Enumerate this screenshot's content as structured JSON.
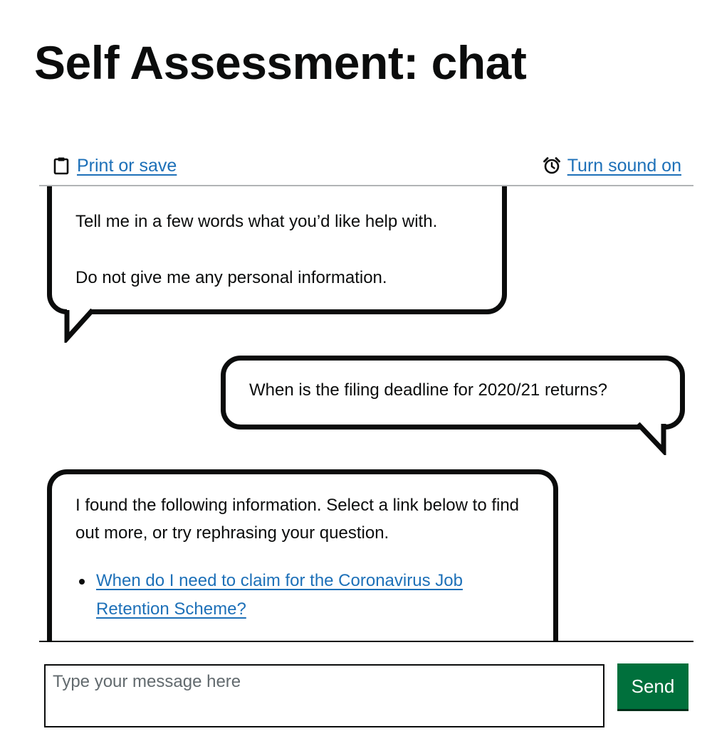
{
  "page": {
    "title": "Self Assessment: chat"
  },
  "toolbar": {
    "print_label": "Print or save",
    "print_icon": "clipboard-icon",
    "sound_label": "Turn sound on",
    "sound_icon": "alarm-clock-icon",
    "link_color": "#1d70b8"
  },
  "messages": [
    {
      "sender": "advisor",
      "paragraphs": [
        "Tell me in a few words what you’d like help with.",
        "Do not give me any personal information."
      ]
    },
    {
      "sender": "user",
      "paragraphs": [
        "When is the filing deadline for 2020/21 returns?"
      ]
    },
    {
      "sender": "advisor",
      "paragraphs": [
        "I found the following information. Select a link below to find out more, or try rephrasing your question."
      ],
      "links": [
        "When do I need to claim for the Coronavirus Job Retention Scheme?"
      ]
    }
  ],
  "composer": {
    "placeholder": "Type your message here",
    "send_label": "Send",
    "send_color": "#00703c"
  }
}
